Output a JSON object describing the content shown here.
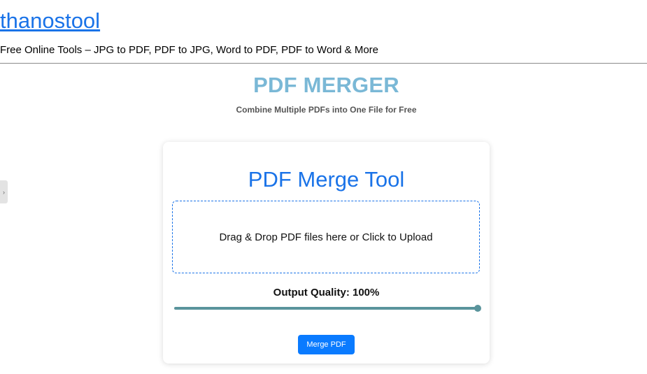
{
  "site": {
    "title": "thanostool",
    "tagline": "Free Online Tools – JPG to PDF, PDF to JPG, Word to PDF, PDF to Word & More"
  },
  "page": {
    "title": "PDF MERGER",
    "subtitle": "Combine Multiple PDFs into One File for Free"
  },
  "tool": {
    "title": "PDF Merge Tool",
    "dropzone_text": "Drag & Drop PDF files here or Click to Upload",
    "quality_label": "Output Quality: 100%",
    "quality_value": 100,
    "merge_button": "Merge PDF"
  },
  "side_toggle": {
    "glyph": "›"
  },
  "colors": {
    "link": "#1a73e8",
    "page_title": "#7ab8d6",
    "slider": "#5a949c",
    "button": "#0a7bff"
  }
}
